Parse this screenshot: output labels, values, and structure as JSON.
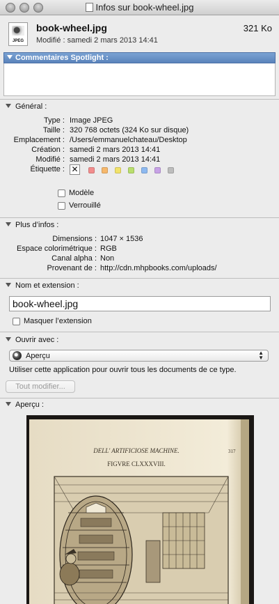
{
  "window": {
    "title": "Infos sur book-wheel.jpg"
  },
  "header": {
    "file_name": "book-wheel.jpg",
    "file_size": "321 Ko",
    "modified": "Modifié : samedi 2 mars 2013 14:41",
    "icon_label": "JPEG"
  },
  "spotlight": {
    "label": "Commentaires Spotlight :",
    "value": ""
  },
  "general": {
    "header": "Général :",
    "rows": [
      {
        "label": "Type :",
        "value": "Image JPEG"
      },
      {
        "label": "Taille :",
        "value": "320 768 octets (324 Ko sur disque)"
      },
      {
        "label": "Emplacement :",
        "value": "/Users/emmanuelchateau/Desktop"
      },
      {
        "label": "Création :",
        "value": "samedi 2 mars 2013 14:41"
      },
      {
        "label": "Modifié :",
        "value": "samedi 2 mars 2013 14:41"
      }
    ],
    "etiquette_label": "Étiquette :",
    "tag_colors": [
      "#f28d8d",
      "#f6b86c",
      "#f1e26a",
      "#b9de6d",
      "#8db9f0",
      "#c7a2e6",
      "#bdbdbd"
    ],
    "modele_label": "Modèle",
    "verrouille_label": "Verrouillé",
    "modele_checked": false,
    "verrouille_checked": false
  },
  "more_info": {
    "header": "Plus d’infos :",
    "rows": [
      {
        "label": "Dimensions :",
        "value": "1047 × 1536"
      },
      {
        "label": "Espace colorimétrique :",
        "value": "RGB"
      },
      {
        "label": "Canal alpha :",
        "value": "Non"
      },
      {
        "label": "Provenant de :",
        "value": "http://cdn.mhpbooks.com/uploads/"
      }
    ]
  },
  "name_ext": {
    "header": "Nom et extension :",
    "value": "book-wheel.jpg",
    "hide_ext_label": "Masquer l’extension",
    "hide_ext_checked": false
  },
  "open_with": {
    "header": "Ouvrir avec :",
    "app": "Aperçu",
    "description": "Utiliser cette application pour ouvrir tous les documents de ce type.",
    "change_all_label": "Tout modifier..."
  },
  "preview": {
    "header": "Aperçu :",
    "page_header": "DELL' ARTIFICIOSE MACHINE.",
    "page_number": "317",
    "figure_label": "FIGVRE CLXXXVIII."
  }
}
